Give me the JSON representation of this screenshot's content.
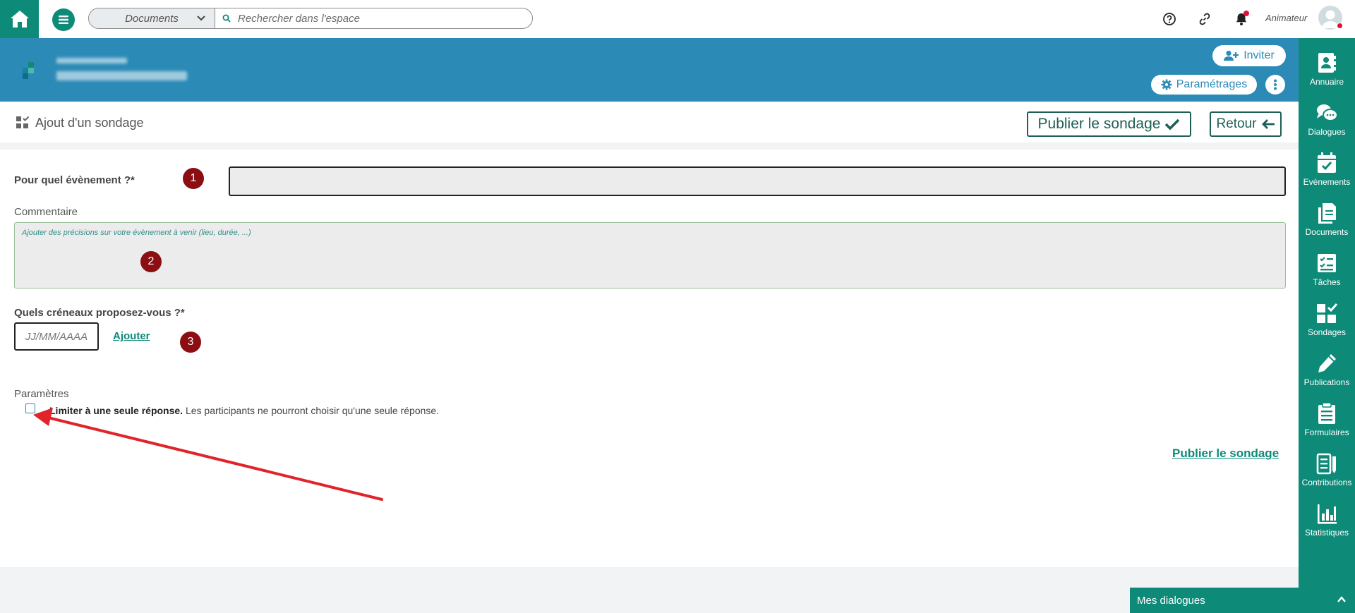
{
  "topbar": {
    "search_scope": "Documents",
    "search_placeholder": "Rechercher dans l'espace",
    "user_role": "Animateur"
  },
  "header": {
    "invite_label": "Inviter",
    "settings_label": "Paramétrages"
  },
  "page": {
    "title": "Ajout d'un sondage",
    "publish_label": "Publier le sondage",
    "back_label": "Retour"
  },
  "form": {
    "event_label": "Pour quel évènement ?*",
    "comment_label": "Commentaire",
    "comment_placeholder": "Ajouter des précisions sur votre évènement à venir (lieu, durée, ...)",
    "slots_label": "Quels créneaux proposez-vous ?*",
    "date_placeholder": "JJ/MM/AAAA",
    "add_label": "Ajouter",
    "params_label": "Paramètres",
    "limit_bold": "Limiter à une seule réponse.",
    "limit_text": " Les participants ne pourront choisir qu'une seule réponse.",
    "publish_link": "Publier le sondage",
    "badges": [
      "1",
      "2",
      "3"
    ]
  },
  "sidebar": {
    "items": [
      {
        "label": "Annuaire",
        "icon": "address-book-icon"
      },
      {
        "label": "Dialogues",
        "icon": "chat-bubbles-icon"
      },
      {
        "label": "Evènements",
        "icon": "calendar-check-icon"
      },
      {
        "label": "Documents",
        "icon": "documents-icon"
      },
      {
        "label": "Tâches",
        "icon": "task-list-icon"
      },
      {
        "label": "Sondages",
        "icon": "poll-icon"
      },
      {
        "label": "Publications",
        "icon": "pencil-icon"
      },
      {
        "label": "Formulaires",
        "icon": "clipboard-icon"
      },
      {
        "label": "Contributions",
        "icon": "contributions-icon"
      },
      {
        "label": "Statistiques",
        "icon": "bar-chart-icon"
      }
    ]
  },
  "dialogs_bar": {
    "label": "Mes dialogues"
  },
  "colors": {
    "brand_green": "#0d8a78",
    "banner_blue": "#2c8ab6",
    "badge_red": "#8b0e12",
    "arrow_red": "#e0242a"
  }
}
